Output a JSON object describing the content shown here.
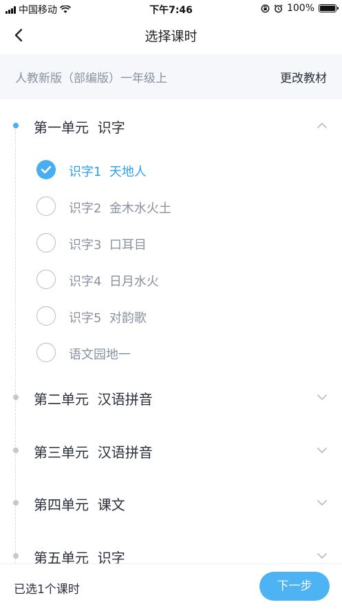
{
  "status_bar": {
    "carrier": "中国移动",
    "time": "下午7:46",
    "battery": "100%",
    "battery_level": 1.0
  },
  "nav": {
    "title": "选择课时",
    "back_icon": "chevron-left-icon"
  },
  "textbook": {
    "name": "人教新版（部编版）一年级上",
    "change_label": "更改教材"
  },
  "units": [
    {
      "title": "第一单元  识字",
      "expanded": true,
      "lessons": [
        {
          "label": "识字1  天地人",
          "checked": true
        },
        {
          "label": "识字2  金木水火土",
          "checked": false
        },
        {
          "label": "识字3  口耳目",
          "checked": false
        },
        {
          "label": "识字4  日月水火",
          "checked": false
        },
        {
          "label": "识字5  对韵歌",
          "checked": false
        },
        {
          "label": "语文园地一",
          "checked": false
        }
      ]
    },
    {
      "title": "第二单元  汉语拼音",
      "expanded": false
    },
    {
      "title": "第三单元  汉语拼音",
      "expanded": false
    },
    {
      "title": "第四单元  课文",
      "expanded": false
    },
    {
      "title": "第五单元  识字",
      "expanded": false
    }
  ],
  "footer": {
    "selected_text": "已选1个课时",
    "next_label": "下一步"
  },
  "colors": {
    "accent": "#47aef2",
    "accent_text": "#2aa1f2",
    "muted_text": "#8a90a0",
    "dark_text": "#2a2f3b"
  }
}
